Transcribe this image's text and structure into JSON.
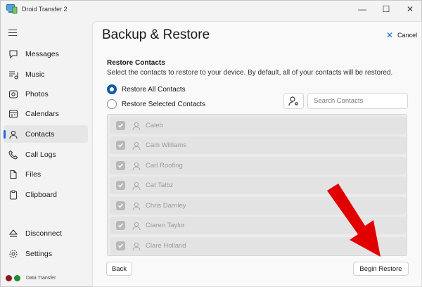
{
  "window": {
    "title": "Droid Transfer 2",
    "minimize_glyph": "—",
    "maximize_glyph": "☐",
    "close_glyph": "✕"
  },
  "sidebar": {
    "items": [
      {
        "label": "Messages",
        "icon": "messages-icon"
      },
      {
        "label": "Music",
        "icon": "music-icon"
      },
      {
        "label": "Photos",
        "icon": "photos-icon"
      },
      {
        "label": "Calendars",
        "icon": "calendar-icon"
      },
      {
        "label": "Contacts",
        "icon": "contacts-icon",
        "active": true
      },
      {
        "label": "Call Logs",
        "icon": "phone-icon"
      },
      {
        "label": "Files",
        "icon": "file-icon"
      },
      {
        "label": "Clipboard",
        "icon": "clipboard-icon"
      }
    ],
    "bottom_items": [
      {
        "label": "Disconnect",
        "icon": "eject-icon"
      },
      {
        "label": "Settings",
        "icon": "gear-icon"
      }
    ],
    "status_text": "Data Transfer",
    "status_colors": [
      "#8b1a1a",
      "#1f8b2e"
    ]
  },
  "main": {
    "title": "Backup & Restore",
    "cancel_label": "Cancel",
    "section_title": "Restore Contacts",
    "section_desc": "Select the contacts to restore to your device. By default, all of your contacts will be restored.",
    "radio_all": "Restore All Contacts",
    "radio_selected": "Restore Selected Contacts",
    "radio_all_checked": true,
    "search_placeholder": "Search Contacts",
    "contacts": [
      "Caleb",
      "Cam Williams",
      "Carl Roofing",
      "Cat Talbz",
      "Chris Darnley",
      "Ciaren Taylor",
      "Clare Holland"
    ],
    "back_label": "Back",
    "begin_label": "Begin Restore",
    "accent_color": "#0e5aa7",
    "annotation_arrow_color": "#e10000"
  }
}
